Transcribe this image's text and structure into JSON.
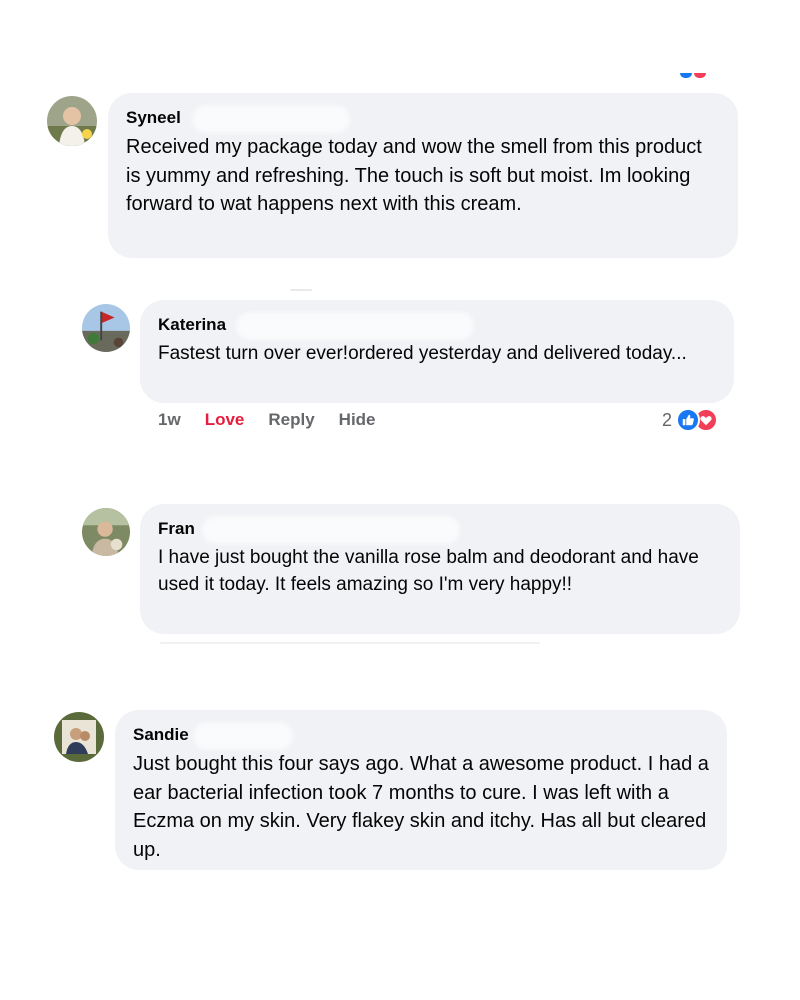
{
  "comments": [
    {
      "name": "Syneel",
      "text": "Received my package today and wow the smell from this product is yummy and refreshing. The touch is soft but moist. Im looking forward to wat happens next with this cream."
    },
    {
      "name": "Katerina",
      "text": "Fastest turn over ever!ordered yesterday and delivered today...",
      "actions": {
        "time": "1w",
        "love": "Love",
        "reply": "Reply",
        "hide": "Hide"
      },
      "reaction_count": "2",
      "reaction_icons": [
        "like-icon",
        "heart-icon"
      ]
    },
    {
      "name": "Fran",
      "text": "I have just bought the vanilla rose balm and deodorant and have used it today. It feels amazing so I'm very happy!!"
    },
    {
      "name": "Sandie",
      "text": "Just bought this four says ago. What a awesome product. I had a ear bacterial infection took 7 months to cure. I was left with a Eczma on my skin. Very flakey skin and itchy. Has all but cleared up."
    }
  ],
  "colors": {
    "bubble": "#f0f2f5",
    "love": "#e41e3f",
    "action_gray": "#65676b",
    "like_blue": "#1877f2",
    "heart_red": "#f33e58"
  }
}
